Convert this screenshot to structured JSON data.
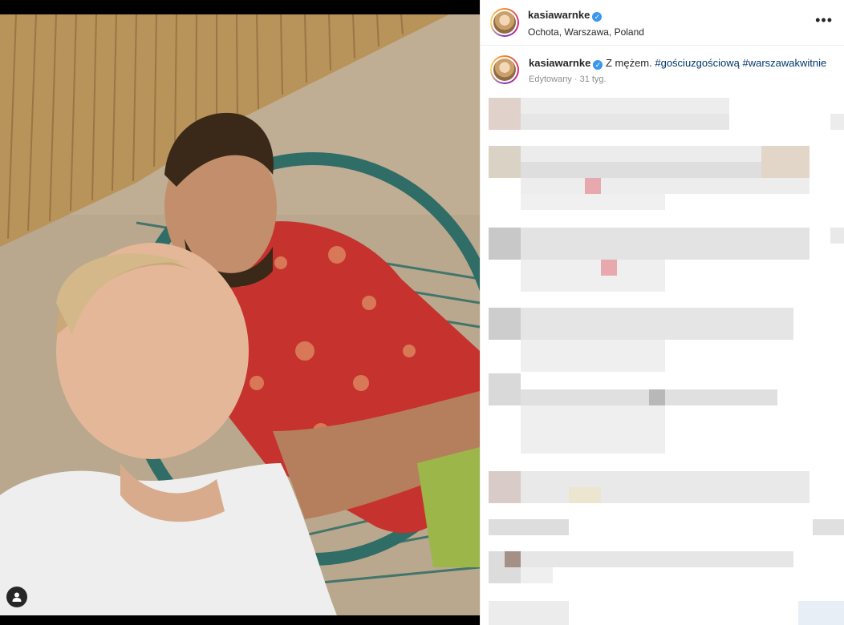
{
  "post": {
    "header": {
      "username": "kasiawarnke",
      "location": "Ochota, Warszawa, Poland",
      "more_icon": "more-horizontal-icon"
    },
    "caption": {
      "username": "kasiawarnke",
      "text": " Z mężem. ",
      "hashtags": [
        "#gościuzgościową",
        "#warszawakwitnie"
      ],
      "edited": "Edytowany · 31 tyg."
    },
    "photo": {
      "description_icon": "user-tag-icon"
    }
  },
  "colors": {
    "hashtag": "#00376b",
    "verified": "#3897f0",
    "border": "#efefef"
  }
}
